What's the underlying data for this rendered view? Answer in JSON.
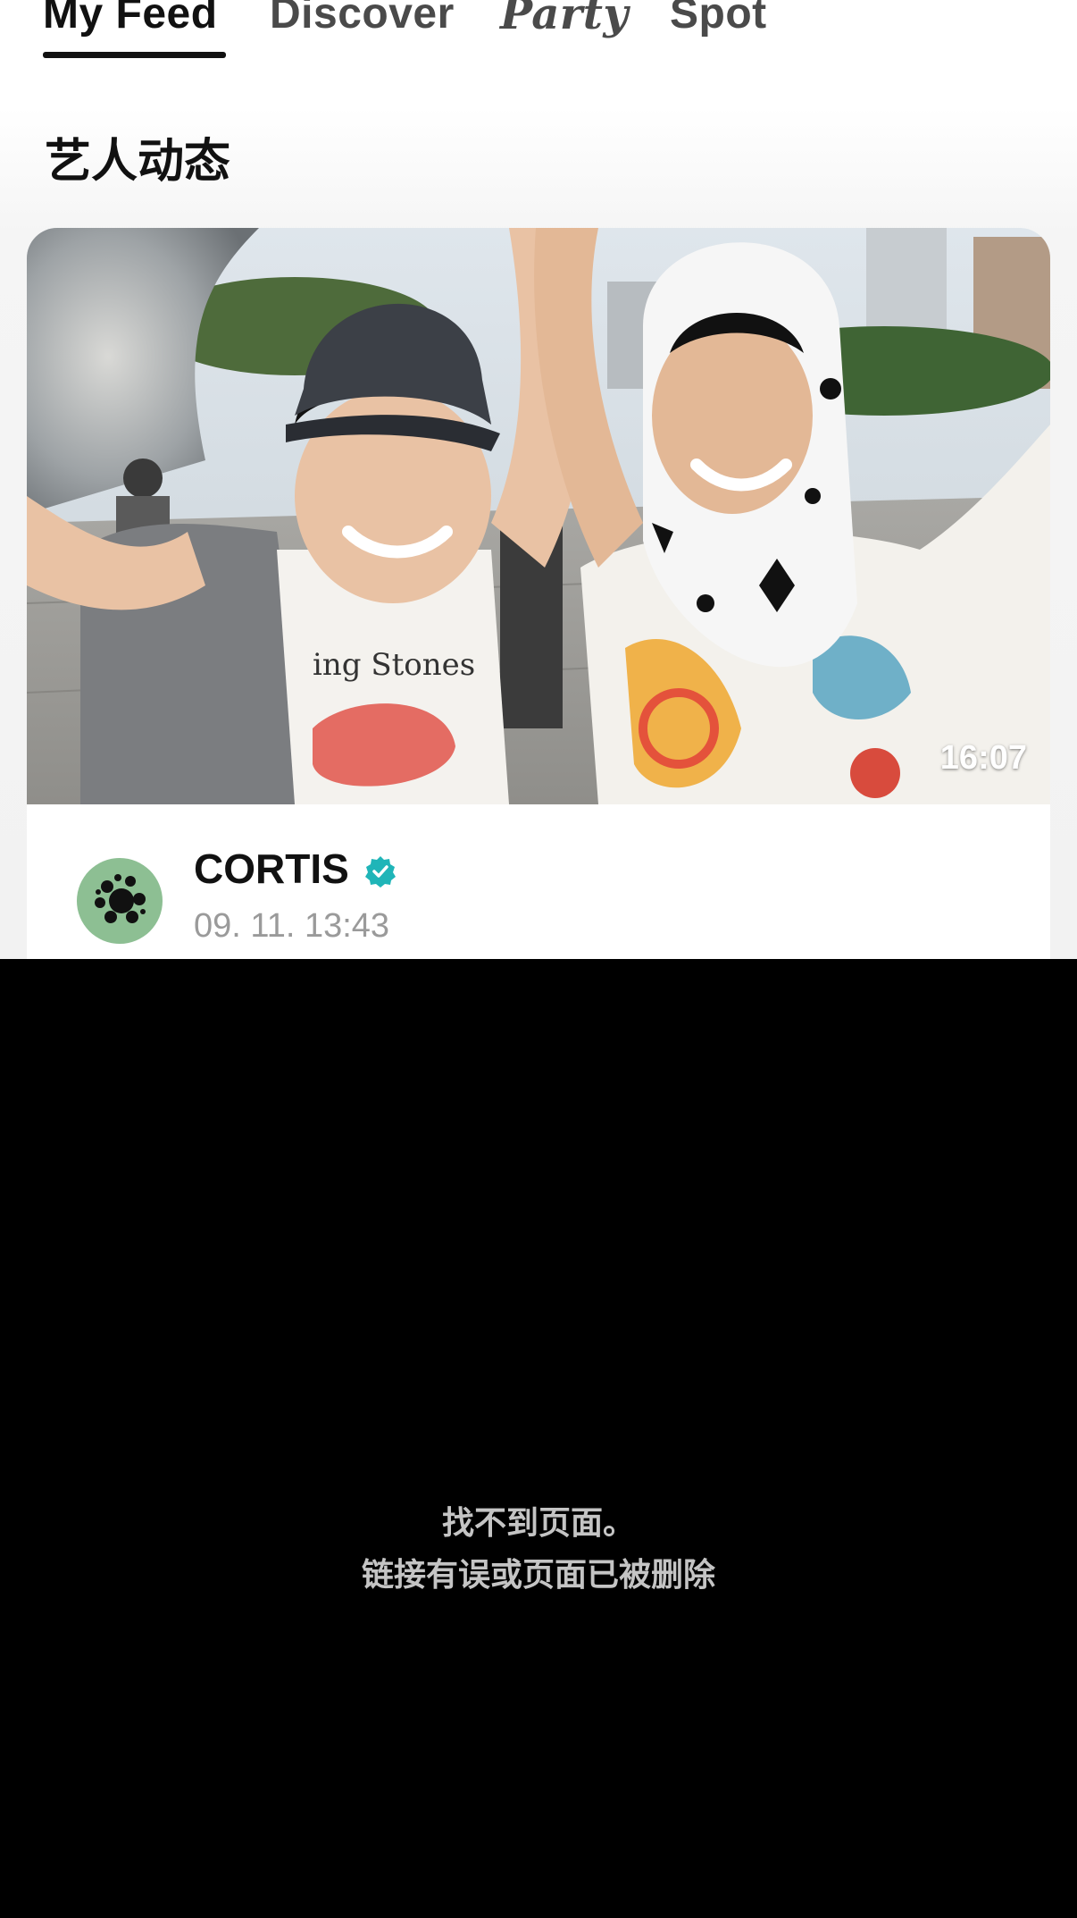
{
  "tabs": [
    {
      "label": "My Feed",
      "active": true
    },
    {
      "label": "Discover",
      "active": false
    },
    {
      "label": "Party",
      "active": false
    },
    {
      "label": "Spot",
      "active": false
    }
  ],
  "section": {
    "title": "艺人动态"
  },
  "post": {
    "duration": "16:07",
    "author": "CORTIS",
    "time": "09. 11. 13:43",
    "verified": true
  },
  "error": {
    "line1": "找不到页面。",
    "line2": "链接有误或页面已被删除"
  },
  "colors": {
    "background": "#000000",
    "verified_badge": "#1fb5b8",
    "avatar_bg": "#8dbf93",
    "error_text": "#c4c4c4"
  }
}
